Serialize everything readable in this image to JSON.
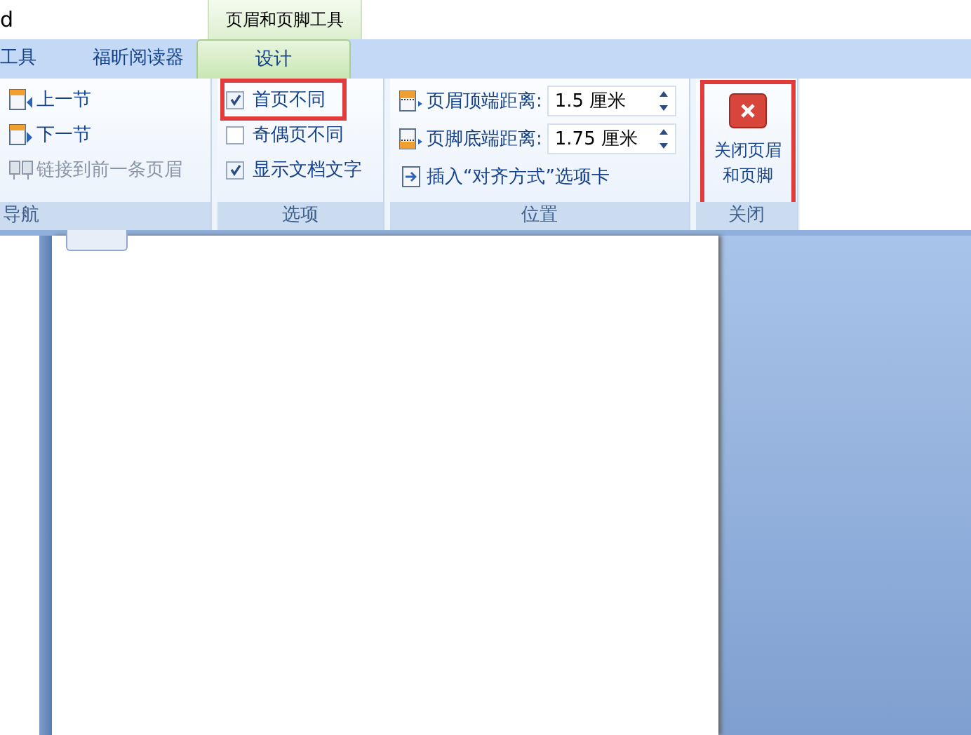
{
  "window": {
    "title": "d"
  },
  "contextual_tab_group": {
    "label": "页眉和页脚工具"
  },
  "tabs": [
    {
      "label": "工具",
      "selected": false
    },
    {
      "label": "福昕阅读器",
      "selected": false
    },
    {
      "label": "设计",
      "selected": true
    }
  ],
  "ribbon": {
    "groups": [
      {
        "kind": "navigation",
        "label": "导航",
        "items": [
          {
            "kind": "previous",
            "label": "上一节",
            "disabled": false
          },
          {
            "kind": "next",
            "label": "下一节",
            "disabled": false
          },
          {
            "kind": "link",
            "label": "链接到前一条页眉",
            "disabled": true
          }
        ]
      },
      {
        "kind": "options",
        "label": "选项",
        "items": [
          {
            "label": "首页不同",
            "checked": true,
            "highlighted": true
          },
          {
            "label": "奇偶页不同",
            "checked": false,
            "highlighted": false
          },
          {
            "label": "显示文档文字",
            "checked": true,
            "highlighted": false
          }
        ]
      },
      {
        "kind": "position",
        "label": "位置",
        "fields": [
          {
            "kind": "header",
            "label": "页眉顶端距离:",
            "value": "1.5 厘米"
          },
          {
            "kind": "footer",
            "label": "页脚底端距离:",
            "value": "1.75 厘米"
          }
        ],
        "command": "插入“对齐方式”选项卡"
      },
      {
        "kind": "close",
        "label": "关闭",
        "button": {
          "lines": [
            "关闭页眉",
            "和页脚"
          ],
          "highlighted": true
        }
      }
    ]
  }
}
